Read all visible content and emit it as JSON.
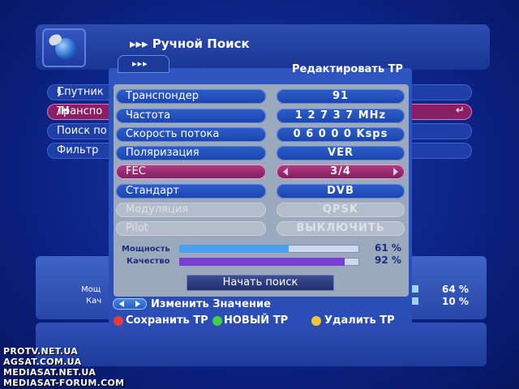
{
  "header": {
    "title": "▸▸▸ Ручной Поиск"
  },
  "background_menu": {
    "items": [
      {
        "label": "Спутник",
        "right": ")"
      },
      {
        "label": "Транспо",
        "right": "/H"
      },
      {
        "label": "Поиск по",
        "right": ""
      },
      {
        "label": "Фильтр",
        "right": ""
      }
    ],
    "meters": [
      {
        "label": "Мощ",
        "pct": "64 %"
      },
      {
        "label": "Кач",
        "pct": "10 %"
      }
    ]
  },
  "dialog": {
    "tab": "▸▸▸",
    "title": "Редактировать ТР",
    "fields": [
      {
        "label": "Транспондер",
        "value": "91"
      },
      {
        "label": "Частота",
        "value": "1 2 7 3 7   MHz"
      },
      {
        "label": "Скорость потока",
        "value": "0 6 0 0 0  Ksps"
      },
      {
        "label": "Поляризация",
        "value": "VER"
      },
      {
        "label": "FEC",
        "value": "3/4"
      },
      {
        "label": "Стандарт",
        "value": "DVB"
      },
      {
        "label": "Модуляция",
        "value": "QPSK"
      },
      {
        "label": "Pilot",
        "value": "ВЫКЛЮЧИТЬ"
      }
    ],
    "meters": [
      {
        "label": "Мощность",
        "pct": "61 %",
        "fraction": 0.61,
        "color": "#4b9ff0"
      },
      {
        "label": "Качество",
        "pct": "92 %",
        "fraction": 0.92,
        "color": "#7a3fd0"
      }
    ],
    "start_button": "Начать поиск"
  },
  "hints": {
    "change_value": "Изменить Значение",
    "save": "Сохранить ТР",
    "new": "НОВЫЙ ТР",
    "delete": "Удалить ТР",
    "colors": {
      "red": "#e83a3a",
      "green": "#3fd13f",
      "yellow": "#f2c23a"
    }
  },
  "watermarks": [
    "PROTV.NET.UA",
    "AGSAT.COM.UA",
    "MEDIASAT.NET.UA",
    "MEDIASAT-FORUM.COM"
  ]
}
